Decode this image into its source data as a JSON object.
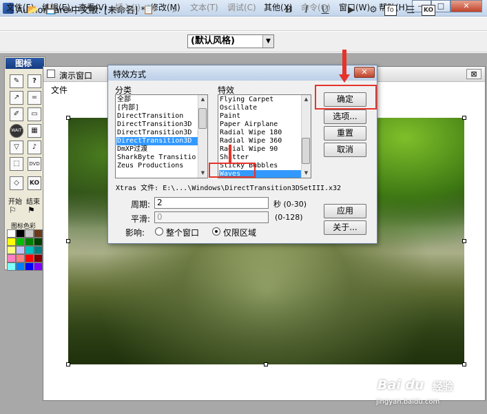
{
  "window": {
    "title": "Authorware 中文版: [未命名] *",
    "buttons": {
      "minimize": "—",
      "maximize": "□",
      "close": "✕"
    }
  },
  "menubar": [
    {
      "label": "文件(F)",
      "enabled": true
    },
    {
      "label": "编辑(E)",
      "enabled": true
    },
    {
      "label": "查看(V)",
      "enabled": true
    },
    {
      "label": "插入(I)",
      "enabled": false
    },
    {
      "label": "修改(M)",
      "enabled": true
    },
    {
      "label": "文本(T)",
      "enabled": false
    },
    {
      "label": "调试(C)",
      "enabled": false
    },
    {
      "label": "其他(X)",
      "enabled": true
    },
    {
      "label": "命令(O)",
      "enabled": false
    },
    {
      "label": "窗口(W)",
      "enabled": true
    },
    {
      "label": "帮助(H)",
      "enabled": true
    }
  ],
  "toolbar": {
    "style_select": "(默认风格)",
    "bold": "B",
    "italic": "I",
    "underline": "U",
    "icons": [
      "new-file-icon",
      "open-file-icon",
      "save-icon",
      "import-icon",
      "undo-icon",
      "cut-icon",
      "copy-icon",
      "paste-icon",
      "find-icon",
      "bold-icon",
      "italic-icon",
      "underline-icon",
      "run-icon",
      "control-panel-icon",
      "functions-icon",
      "variables-icon",
      "knowledge-objects-icon"
    ],
    "fn_label": "fo",
    "ko_label": "KO"
  },
  "palette": {
    "title": "图标",
    "start_label": "开始",
    "end_label": "结束",
    "colors_label": "图标色彩",
    "wait_label": "WAIT",
    "ko_label": "KO",
    "dvd_label": "DVD",
    "swatches": [
      "#ffffff",
      "#000000",
      "#c8c8c8",
      "#6b3a1a",
      "#ffff00",
      "#00c000",
      "#008000",
      "#004000",
      "#ffff80",
      "#c0c0ff",
      "#00c0c0",
      "#008080",
      "#ff80c0",
      "#ff8080",
      "#ff0000",
      "#800000",
      "#80ffff",
      "#0080ff",
      "#0000ff",
      "#8000ff"
    ]
  },
  "presentation": {
    "title": "演示窗口",
    "menu_file": "文件",
    "close": "⊠"
  },
  "dialog": {
    "title": "特效方式",
    "close": "✕",
    "category_label": "分类",
    "categories": [
      "全部",
      "[内部]",
      "DirectTransition",
      "DirectTransition3D",
      "DirectTransition3D :",
      "DirectTransition3D :",
      "DmXP过渡",
      "SharkByte Transitio",
      "Zeus Productions"
    ],
    "selected_category": 5,
    "effect_label": "特效",
    "effects": [
      "Flying Carpet",
      "Oscillate",
      "Paint",
      "Paper Airplane",
      "Radial Wipe 180",
      "Radial Wipe 360",
      "Radial Wipe 90",
      "Shatter",
      "Sticky Bubbles",
      "Waves"
    ],
    "selected_effect": 9,
    "xtras_label": "Xtras 文件:",
    "xtras_path": "E:\\...\\Windows\\DirectTransition3DSetIII.x32",
    "period_label": "周期:",
    "period_value": "2",
    "period_unit": "秒 (0-30)",
    "smooth_label": "平滑:",
    "smooth_value": "0",
    "smooth_range": "(0-128)",
    "affect_label": "影响:",
    "radio_whole": "整个窗口",
    "radio_area": "仅限区域",
    "radio_selected": "area",
    "buttons": {
      "ok": "确定",
      "options": "选项...",
      "reset": "重置",
      "cancel": "取消",
      "apply": "应用",
      "about": "关于..."
    }
  },
  "watermark": {
    "logo": "Bai du",
    "text": "经验",
    "url": "jingyan.baidu.com"
  },
  "colors": {
    "highlight": "#e5332a",
    "selection": "#3399ff"
  }
}
